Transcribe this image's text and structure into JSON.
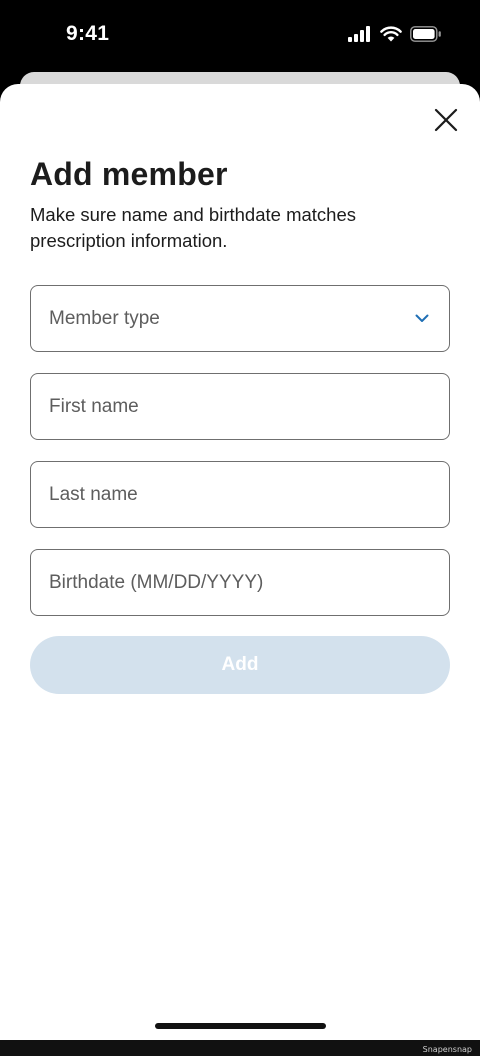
{
  "status_bar": {
    "time": "9:41",
    "icons": [
      "cellular-signal-icon",
      "wifi-icon",
      "battery-icon"
    ]
  },
  "sheet": {
    "close_icon": "close-icon",
    "title": "Add member",
    "subtitle": "Make sure name and birthdate matches prescription information.",
    "fields": {
      "member_type": {
        "placeholder": "Member type",
        "value": "",
        "icon": "chevron-down-icon"
      },
      "first_name": {
        "placeholder": "First name",
        "value": ""
      },
      "last_name": {
        "placeholder": "Last name",
        "value": ""
      },
      "birthdate": {
        "placeholder": "Birthdate (MM/DD/YYYY)",
        "value": ""
      }
    },
    "add_button": {
      "label": "Add",
      "state": "disabled"
    }
  },
  "watermark": "Snapensnap",
  "colors": {
    "sheet_background": "#ffffff",
    "screen_background": "#000000",
    "text_primary": "#1c1c1c",
    "placeholder": "#5d5d5d",
    "field_border": "#6f6f6f",
    "accent_chevron": "#1f6fb5",
    "button_disabled_bg": "#d3e1ed",
    "button_disabled_text": "#ffffff"
  }
}
